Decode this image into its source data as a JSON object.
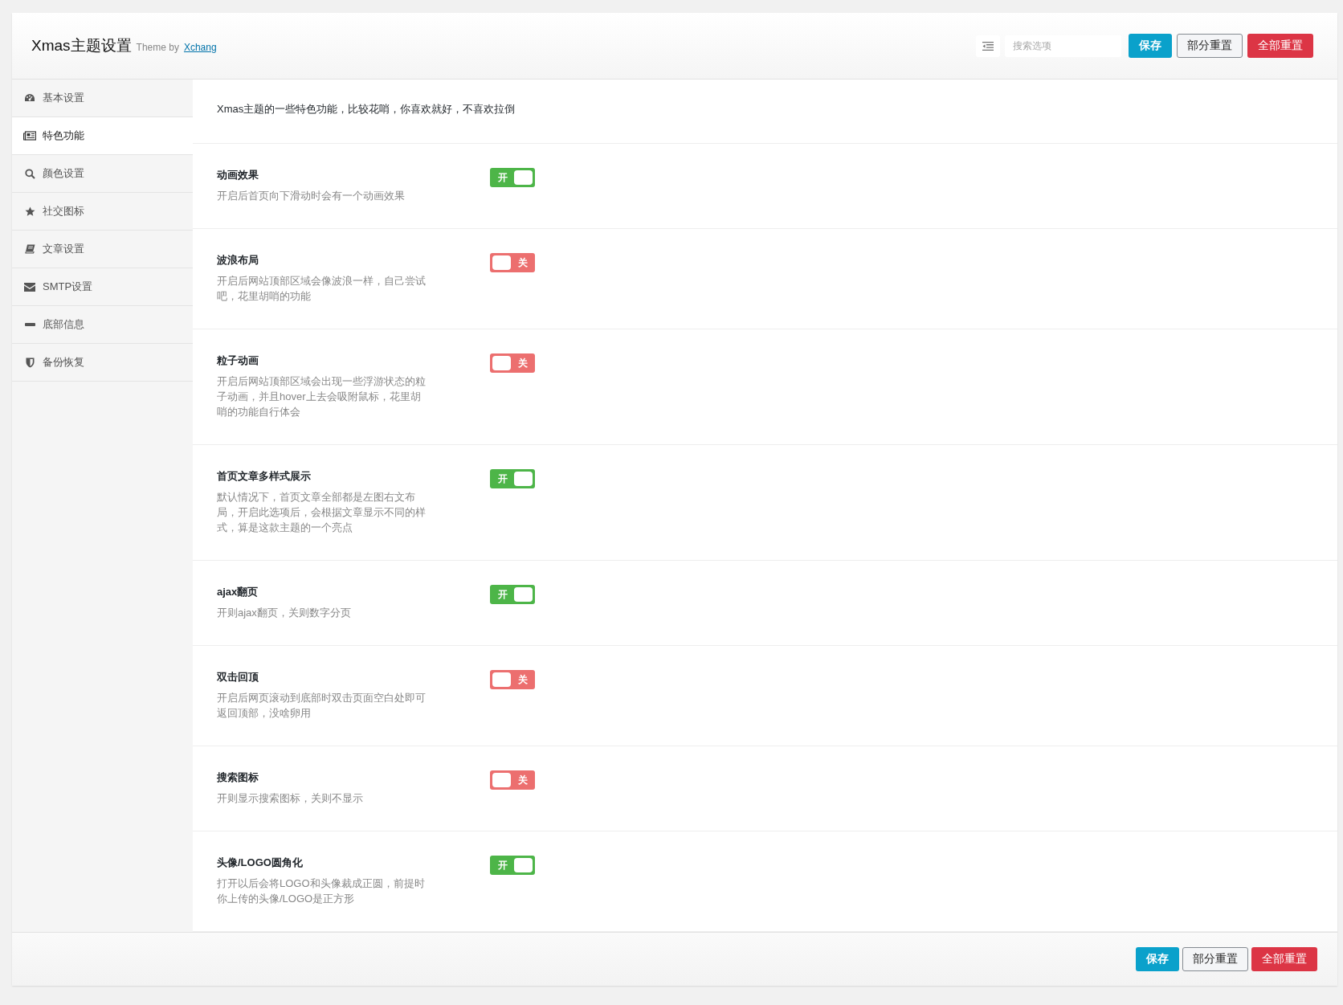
{
  "header": {
    "title": "Xmas主题设置",
    "subtitle": "Theme by",
    "author_link": "Xchang",
    "search": {
      "placeholder": "搜索选项"
    },
    "buttons": [
      {
        "label": "保存",
        "kind": "primary"
      },
      {
        "label": "部分重置",
        "kind": "default"
      },
      {
        "label": "全部重置",
        "kind": "danger"
      }
    ]
  },
  "sidebar": {
    "items": [
      {
        "label": "基本设置",
        "selected": false
      },
      {
        "label": "特色功能",
        "selected": true
      },
      {
        "label": "颜色设置",
        "selected": false
      },
      {
        "label": "社交图标",
        "selected": false
      },
      {
        "label": "文章设置",
        "selected": false
      },
      {
        "label": "SMTP设置",
        "selected": false
      },
      {
        "label": "底部信息",
        "selected": false
      },
      {
        "label": "备份恢复",
        "selected": false
      }
    ]
  },
  "content": {
    "intro": "Xmas主题的一些特色功能，比较花哨，你喜欢就好，不喜欢拉倒",
    "options": [
      {
        "title": "动画效果",
        "description": "开启后首页向下滑动时会有一个动画效果",
        "on": true,
        "switch_label": "开"
      },
      {
        "title": "波浪布局",
        "description": "开启后网站顶部区域会像波浪一样，自己尝试吧，花里胡哨的功能",
        "on": false,
        "switch_label": "关"
      },
      {
        "title": "粒子动画",
        "description": "开启后网站顶部区域会出现一些浮游状态的粒子动画，并且hover上去会吸附鼠标，花里胡哨的功能自行体会",
        "on": false,
        "switch_label": "关"
      },
      {
        "title": "首页文章多样式展示",
        "description": "默认情况下，首页文章全部都是左图右文布局，开启此选项后，会根据文章显示不同的样式，算是这款主题的一个亮点",
        "on": true,
        "switch_label": "开"
      },
      {
        "title": "ajax翻页",
        "description": "开则ajax翻页，关则数字分页",
        "on": true,
        "switch_label": "开"
      },
      {
        "title": "双击回顶",
        "description": "开启后网页滚动到底部时双击页面空白处即可返回顶部，没啥卵用",
        "on": false,
        "switch_label": "关"
      },
      {
        "title": "搜索图标",
        "description": "开则显示搜索图标，关则不显示",
        "on": false,
        "switch_label": "关"
      },
      {
        "title": "头像/LOGO圆角化",
        "description": "打开以后会将LOGO和头像裁成正圆，前提时你上传的头像/LOGO是正方形",
        "on": true,
        "switch_label": "开"
      }
    ]
  },
  "footer": {
    "buttons": [
      {
        "label": "保存",
        "kind": "primary"
      },
      {
        "label": "部分重置",
        "kind": "default"
      },
      {
        "label": "全部重置",
        "kind": "danger"
      }
    ]
  }
}
